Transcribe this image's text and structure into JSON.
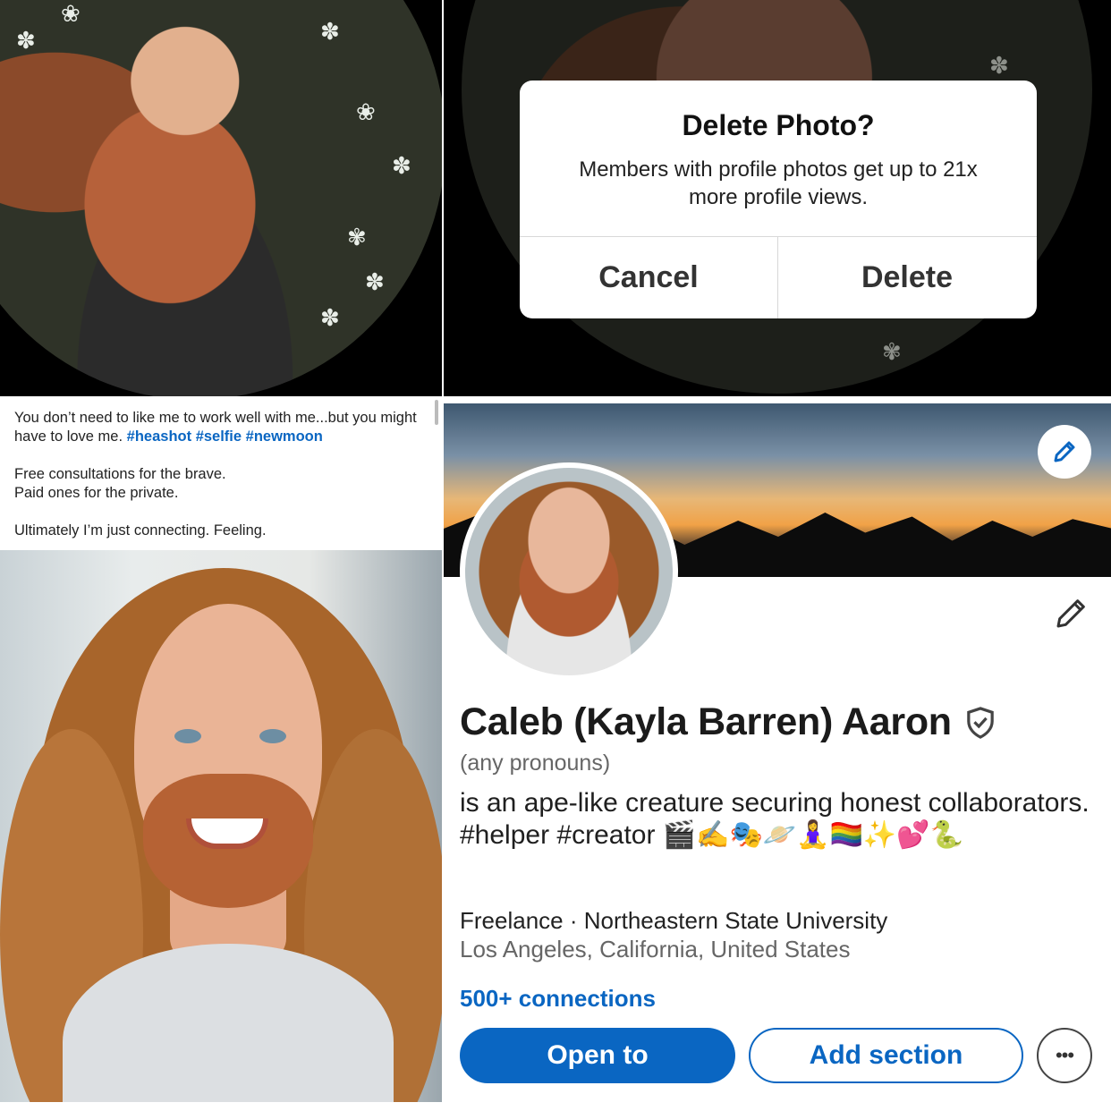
{
  "dialog": {
    "title": "Delete Photo?",
    "message": "Members with profile photos get up to 21x more profile views.",
    "cancel_label": "Cancel",
    "delete_label": "Delete"
  },
  "caption": {
    "line1": "You don’t need to like me to work well with me...but you might have to love me.",
    "hashtags": "#heashot #selfie #newmoon",
    "line2": "Free consultations for the brave.",
    "line3": "Paid ones for the private.",
    "line4": "Ultimately I’m just connecting. Feeling."
  },
  "profile": {
    "name": "Caleb (Kayla Barren) Aaron",
    "pronouns": "(any pronouns)",
    "headline": "is an ape-like creature securing honest collaborators. #helper #creator 🎬✍️🎭🪐🧘‍♀️🏳️‍🌈✨💕🐍",
    "work": "Freelance · Northeastern State University",
    "location": "Los Angeles, California, United States",
    "connections": "500+ connections",
    "open_to_label": "Open to",
    "add_section_label": "Add section",
    "more_label": "•••"
  },
  "colors": {
    "brand_blue": "#0a66c2",
    "dialog_bg": "#ffffff",
    "backdrop": "#000000"
  },
  "icons": {
    "edit_banner": "pencil-icon",
    "edit_intro": "pencil-icon",
    "verified": "shield-check-icon",
    "more": "ellipsis-icon"
  }
}
